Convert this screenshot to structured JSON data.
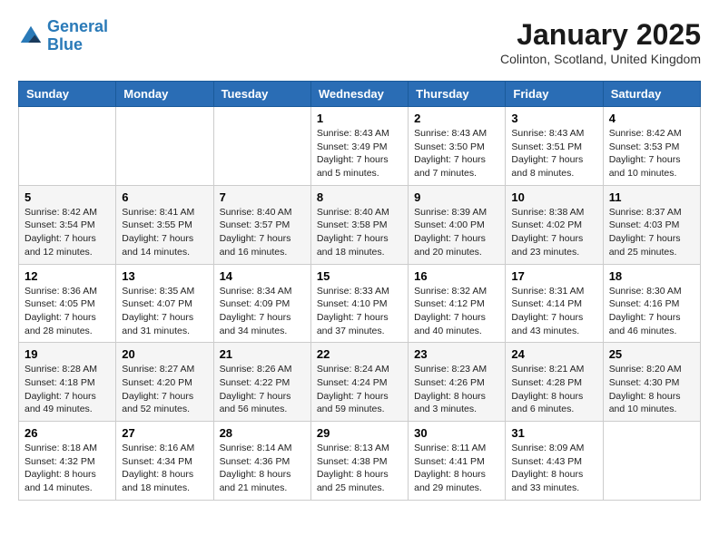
{
  "logo": {
    "line1": "General",
    "line2": "Blue"
  },
  "title": "January 2025",
  "location": "Colinton, Scotland, United Kingdom",
  "days_of_week": [
    "Sunday",
    "Monday",
    "Tuesday",
    "Wednesday",
    "Thursday",
    "Friday",
    "Saturday"
  ],
  "weeks": [
    [
      {
        "day": "",
        "info": ""
      },
      {
        "day": "",
        "info": ""
      },
      {
        "day": "",
        "info": ""
      },
      {
        "day": "1",
        "info": "Sunrise: 8:43 AM\nSunset: 3:49 PM\nDaylight: 7 hours and 5 minutes."
      },
      {
        "day": "2",
        "info": "Sunrise: 8:43 AM\nSunset: 3:50 PM\nDaylight: 7 hours and 7 minutes."
      },
      {
        "day": "3",
        "info": "Sunrise: 8:43 AM\nSunset: 3:51 PM\nDaylight: 7 hours and 8 minutes."
      },
      {
        "day": "4",
        "info": "Sunrise: 8:42 AM\nSunset: 3:53 PM\nDaylight: 7 hours and 10 minutes."
      }
    ],
    [
      {
        "day": "5",
        "info": "Sunrise: 8:42 AM\nSunset: 3:54 PM\nDaylight: 7 hours and 12 minutes."
      },
      {
        "day": "6",
        "info": "Sunrise: 8:41 AM\nSunset: 3:55 PM\nDaylight: 7 hours and 14 minutes."
      },
      {
        "day": "7",
        "info": "Sunrise: 8:40 AM\nSunset: 3:57 PM\nDaylight: 7 hours and 16 minutes."
      },
      {
        "day": "8",
        "info": "Sunrise: 8:40 AM\nSunset: 3:58 PM\nDaylight: 7 hours and 18 minutes."
      },
      {
        "day": "9",
        "info": "Sunrise: 8:39 AM\nSunset: 4:00 PM\nDaylight: 7 hours and 20 minutes."
      },
      {
        "day": "10",
        "info": "Sunrise: 8:38 AM\nSunset: 4:02 PM\nDaylight: 7 hours and 23 minutes."
      },
      {
        "day": "11",
        "info": "Sunrise: 8:37 AM\nSunset: 4:03 PM\nDaylight: 7 hours and 25 minutes."
      }
    ],
    [
      {
        "day": "12",
        "info": "Sunrise: 8:36 AM\nSunset: 4:05 PM\nDaylight: 7 hours and 28 minutes."
      },
      {
        "day": "13",
        "info": "Sunrise: 8:35 AM\nSunset: 4:07 PM\nDaylight: 7 hours and 31 minutes."
      },
      {
        "day": "14",
        "info": "Sunrise: 8:34 AM\nSunset: 4:09 PM\nDaylight: 7 hours and 34 minutes."
      },
      {
        "day": "15",
        "info": "Sunrise: 8:33 AM\nSunset: 4:10 PM\nDaylight: 7 hours and 37 minutes."
      },
      {
        "day": "16",
        "info": "Sunrise: 8:32 AM\nSunset: 4:12 PM\nDaylight: 7 hours and 40 minutes."
      },
      {
        "day": "17",
        "info": "Sunrise: 8:31 AM\nSunset: 4:14 PM\nDaylight: 7 hours and 43 minutes."
      },
      {
        "day": "18",
        "info": "Sunrise: 8:30 AM\nSunset: 4:16 PM\nDaylight: 7 hours and 46 minutes."
      }
    ],
    [
      {
        "day": "19",
        "info": "Sunrise: 8:28 AM\nSunset: 4:18 PM\nDaylight: 7 hours and 49 minutes."
      },
      {
        "day": "20",
        "info": "Sunrise: 8:27 AM\nSunset: 4:20 PM\nDaylight: 7 hours and 52 minutes."
      },
      {
        "day": "21",
        "info": "Sunrise: 8:26 AM\nSunset: 4:22 PM\nDaylight: 7 hours and 56 minutes."
      },
      {
        "day": "22",
        "info": "Sunrise: 8:24 AM\nSunset: 4:24 PM\nDaylight: 7 hours and 59 minutes."
      },
      {
        "day": "23",
        "info": "Sunrise: 8:23 AM\nSunset: 4:26 PM\nDaylight: 8 hours and 3 minutes."
      },
      {
        "day": "24",
        "info": "Sunrise: 8:21 AM\nSunset: 4:28 PM\nDaylight: 8 hours and 6 minutes."
      },
      {
        "day": "25",
        "info": "Sunrise: 8:20 AM\nSunset: 4:30 PM\nDaylight: 8 hours and 10 minutes."
      }
    ],
    [
      {
        "day": "26",
        "info": "Sunrise: 8:18 AM\nSunset: 4:32 PM\nDaylight: 8 hours and 14 minutes."
      },
      {
        "day": "27",
        "info": "Sunrise: 8:16 AM\nSunset: 4:34 PM\nDaylight: 8 hours and 18 minutes."
      },
      {
        "day": "28",
        "info": "Sunrise: 8:14 AM\nSunset: 4:36 PM\nDaylight: 8 hours and 21 minutes."
      },
      {
        "day": "29",
        "info": "Sunrise: 8:13 AM\nSunset: 4:38 PM\nDaylight: 8 hours and 25 minutes."
      },
      {
        "day": "30",
        "info": "Sunrise: 8:11 AM\nSunset: 4:41 PM\nDaylight: 8 hours and 29 minutes."
      },
      {
        "day": "31",
        "info": "Sunrise: 8:09 AM\nSunset: 4:43 PM\nDaylight: 8 hours and 33 minutes."
      },
      {
        "day": "",
        "info": ""
      }
    ]
  ]
}
